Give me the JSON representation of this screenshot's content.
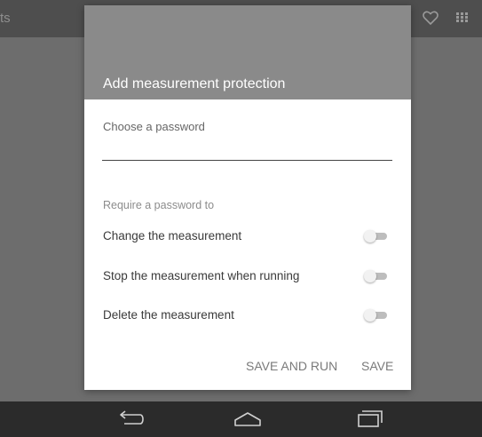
{
  "app": {
    "title_fragment": "ts",
    "icons": [
      "heart-icon",
      "grid-icon"
    ]
  },
  "dialog": {
    "title": "Add measurement protection",
    "password": {
      "label": "Choose a password",
      "value": ""
    },
    "require_label": "Require a password to",
    "options": [
      {
        "label": "Change the measurement",
        "enabled": false
      },
      {
        "label": "Stop the measurement when running",
        "enabled": false
      },
      {
        "label": "Delete the measurement",
        "enabled": false
      }
    ],
    "actions": {
      "save_and_run": "SAVE AND RUN",
      "save": "SAVE"
    }
  },
  "navbar": {
    "icons": [
      "back-icon",
      "home-icon",
      "recents-icon"
    ]
  },
  "colors": {
    "dialog_header": "#8a8a8a",
    "dimmed_background": "#6d6d6d",
    "navbar": "#2b2b2b"
  }
}
